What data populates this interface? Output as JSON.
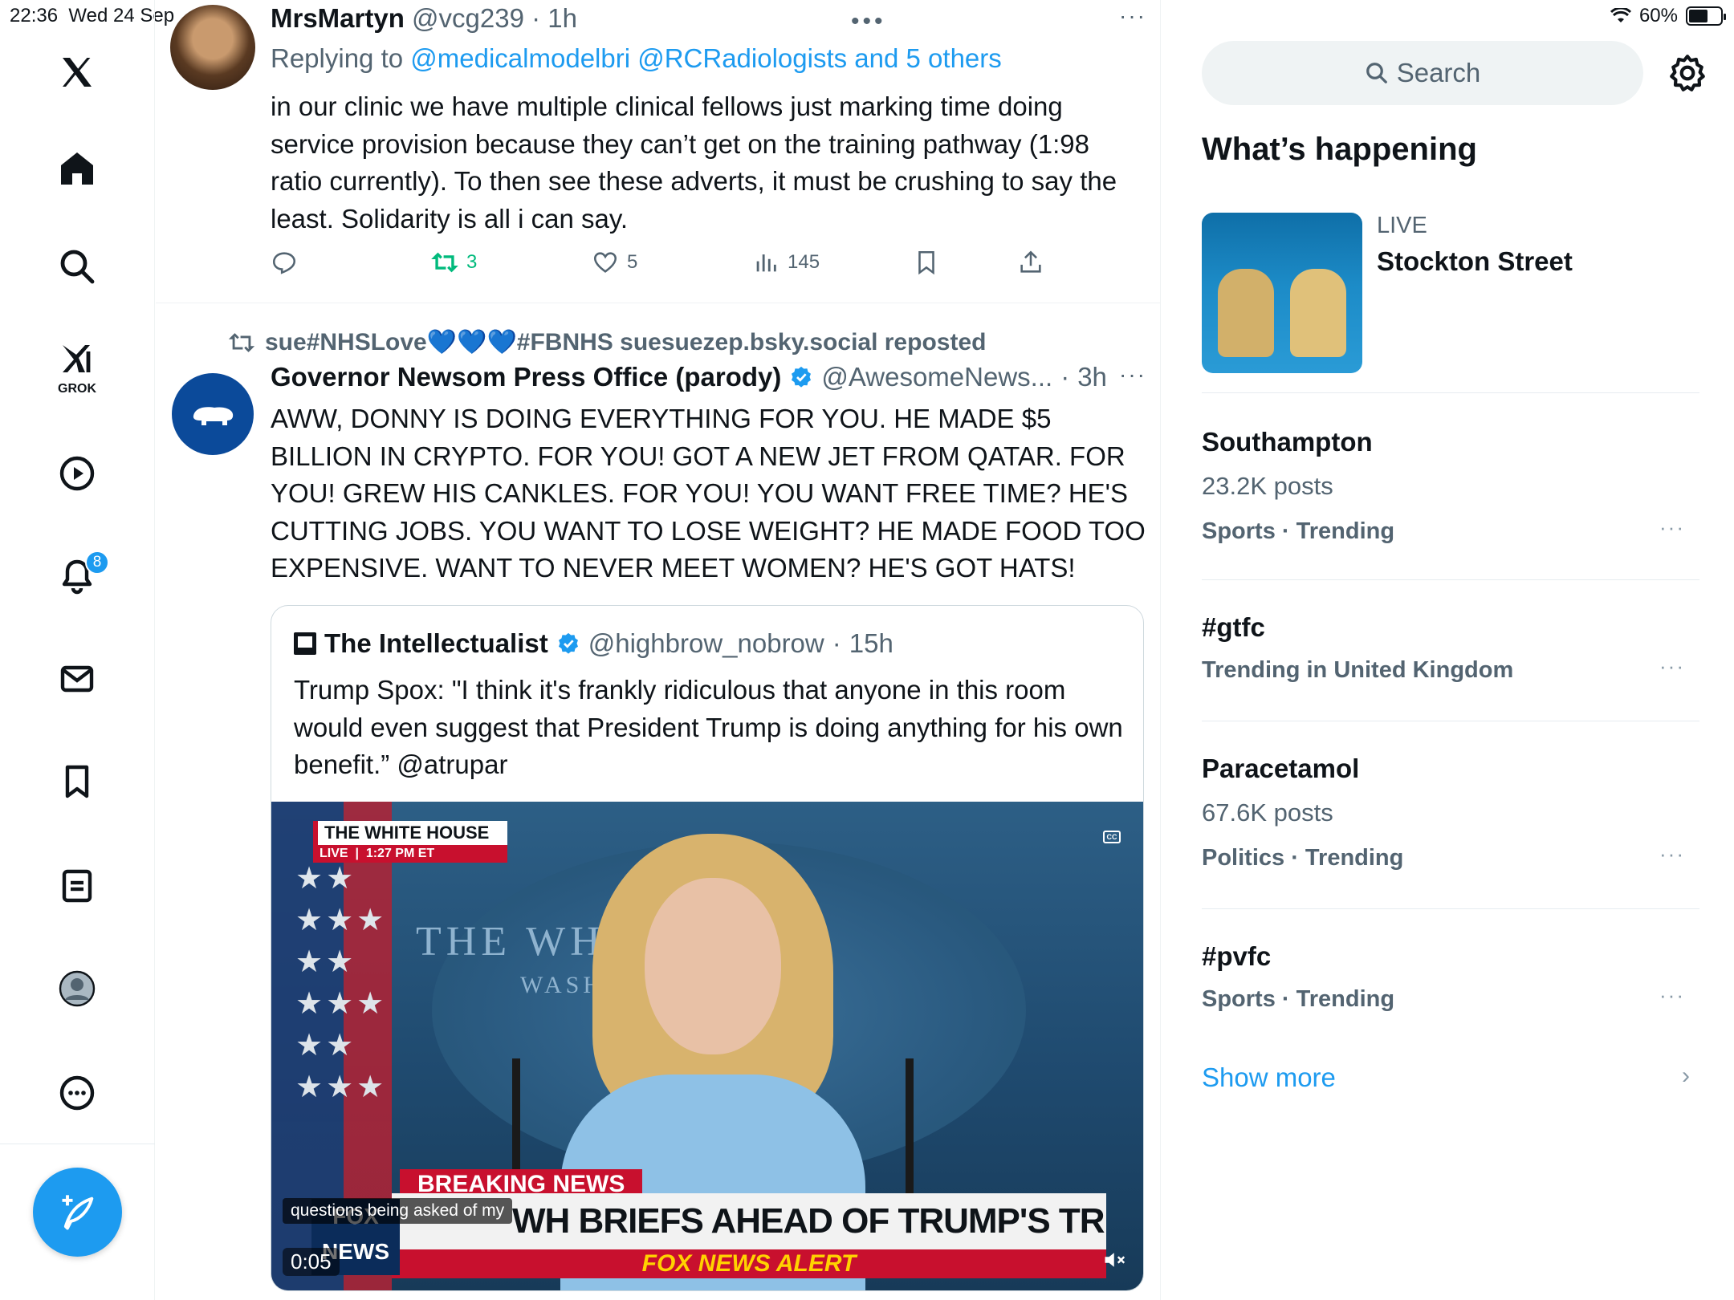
{
  "status_bar": {
    "time": "22:36",
    "date": "Wed 24 Sep",
    "battery": "60%",
    "battery_level": 0.6
  },
  "nav": {
    "notifications_badge": "8",
    "grok_label": "GROK",
    "items": [
      "x-logo",
      "home",
      "search",
      "grok",
      "video",
      "notifications",
      "messages",
      "bookmarks",
      "lists",
      "profile",
      "more"
    ]
  },
  "tweet1": {
    "name": "MrsMartyn",
    "handle": "@vcg239",
    "time": "1h",
    "replying_prefix": "Replying to",
    "replying_to": "@medicalmodelbri @RCRadiologists and 5 others",
    "text": "in our clinic we have multiple clinical fellows just marking time doing service provision because they can’t get on the training pathway (1:98 ratio currently). To then see these adverts, it must be crushing to say the least. Solidarity is all i can say.",
    "retweets": "3",
    "likes": "5",
    "views": "145"
  },
  "tweet2": {
    "reposted_by": "sue#NHSLove💙💙💙#FBNHS suesuezep.bsky.social reposted",
    "name": "Governor Newsom Press Office (parody)",
    "handle": "@AwesomeNews...",
    "time": "3h",
    "text": "AWW, DONNY IS DOING EVERYTHING FOR YOU. HE MADE $5 BILLION IN CRYPTO. FOR YOU! GOT A NEW JET FROM QATAR. FOR YOU! GREW HIS CANKLES. FOR YOU! YOU WANT FREE TIME? HE'S CUTTING JOBS. YOU WANT TO LOSE WEIGHT? HE MADE FOOD TOO EXPENSIVE. WANT TO NEVER MEET WOMEN? HE'S GOT HATS!"
  },
  "quote": {
    "name": "The Intellectualist",
    "handle": "@highbrow_nobrow",
    "time": "15h",
    "text": "Trump Spox: \"I think it's frankly ridiculous that anyone in this room would even suggest that President Trump is doing anything for his own benefit.” @atrupar",
    "video": {
      "location_label": "THE WHITE HOUSE",
      "live_label": "LIVE",
      "live_time": "1:27 PM ET",
      "backdrop_text": "THE WHIT     SE",
      "backdrop_sub": "WASHI",
      "breaking": "BREAKING NEWS",
      "headline": "WH BRIEFS AHEAD OF TRUMP'S TRIP TO THE MIDEAST",
      "alert": "FOX NEWS ALERT",
      "network": "FOX NEWS",
      "caption": "questions being asked of my",
      "timestamp": "0:05",
      "cc": "CC"
    }
  },
  "sidebar": {
    "search_placeholder": "Search",
    "section_title": "What’s happening",
    "live": {
      "label": "LIVE",
      "title": "Stockton Street"
    },
    "trends": [
      {
        "name": "Southampton",
        "posts": "23.2K posts",
        "meta": "Sports · Trending"
      },
      {
        "name": "#gtfc",
        "posts": "",
        "meta": "Trending in United Kingdom"
      },
      {
        "name": "Paracetamol",
        "posts": "67.6K posts",
        "meta": "Politics · Trending"
      },
      {
        "name": "#pvfc",
        "posts": "",
        "meta": "Sports · Trending"
      }
    ],
    "show_more": "Show more"
  },
  "colors": {
    "accent": "#1d9bf0",
    "text": "#0f1419",
    "muted": "#536471",
    "retweet_green": "#00ba7c"
  }
}
